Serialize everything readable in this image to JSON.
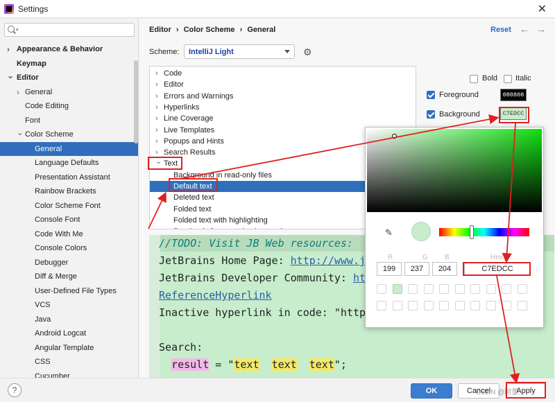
{
  "window": {
    "title": "Settings"
  },
  "sidebar": {
    "search_placeholder": "",
    "items": [
      {
        "label": "Appearance & Behavior",
        "level": 0,
        "bold": true,
        "chevron": "right"
      },
      {
        "label": "Keymap",
        "level": 0,
        "bold": true,
        "chevron": ""
      },
      {
        "label": "Editor",
        "level": 0,
        "bold": true,
        "chevron": "down"
      },
      {
        "label": "General",
        "level": 1,
        "bold": false,
        "chevron": "right"
      },
      {
        "label": "Code Editing",
        "level": 1,
        "bold": false,
        "chevron": ""
      },
      {
        "label": "Font",
        "level": 1,
        "bold": false,
        "chevron": ""
      },
      {
        "label": "Color Scheme",
        "level": 1,
        "bold": false,
        "chevron": "down"
      },
      {
        "label": "General",
        "level": 2,
        "bold": false,
        "chevron": "",
        "selected": true
      },
      {
        "label": "Language Defaults",
        "level": 2,
        "bold": false,
        "chevron": ""
      },
      {
        "label": "Presentation Assistant",
        "level": 2,
        "bold": false,
        "chevron": ""
      },
      {
        "label": "Rainbow Brackets",
        "level": 2,
        "bold": false,
        "chevron": ""
      },
      {
        "label": "Color Scheme Font",
        "level": 2,
        "bold": false,
        "chevron": ""
      },
      {
        "label": "Console Font",
        "level": 2,
        "bold": false,
        "chevron": ""
      },
      {
        "label": "Code With Me",
        "level": 2,
        "bold": false,
        "chevron": ""
      },
      {
        "label": "Console Colors",
        "level": 2,
        "bold": false,
        "chevron": ""
      },
      {
        "label": "Debugger",
        "level": 2,
        "bold": false,
        "chevron": ""
      },
      {
        "label": "Diff & Merge",
        "level": 2,
        "bold": false,
        "chevron": ""
      },
      {
        "label": "User-Defined File Types",
        "level": 2,
        "bold": false,
        "chevron": ""
      },
      {
        "label": "VCS",
        "level": 2,
        "bold": false,
        "chevron": ""
      },
      {
        "label": "Java",
        "level": 2,
        "bold": false,
        "chevron": ""
      },
      {
        "label": "Android Logcat",
        "level": 2,
        "bold": false,
        "chevron": ""
      },
      {
        "label": "Angular Template",
        "level": 2,
        "bold": false,
        "chevron": ""
      },
      {
        "label": "CSS",
        "level": 2,
        "bold": false,
        "chevron": ""
      },
      {
        "label": "Cucumber",
        "level": 2,
        "bold": false,
        "chevron": ""
      }
    ]
  },
  "breadcrumb": {
    "part1": "Editor",
    "sep": "›",
    "part2": "Color Scheme",
    "part3": "General"
  },
  "header": {
    "reset": "Reset",
    "back": "←",
    "forward": "→"
  },
  "scheme": {
    "label": "Scheme:",
    "value": "IntelliJ Light"
  },
  "categories": [
    {
      "label": "Code",
      "expanded": false
    },
    {
      "label": "Editor",
      "expanded": false
    },
    {
      "label": "Errors and Warnings",
      "expanded": false
    },
    {
      "label": "Hyperlinks",
      "expanded": false
    },
    {
      "label": "Line Coverage",
      "expanded": false
    },
    {
      "label": "Live Templates",
      "expanded": false
    },
    {
      "label": "Popups and Hints",
      "expanded": false
    },
    {
      "label": "Search Results",
      "expanded": false
    },
    {
      "label": "Text",
      "expanded": true
    },
    {
      "label": "Background in read-only files",
      "child": true
    },
    {
      "label": "Default text",
      "child": true,
      "selected": true
    },
    {
      "label": "Deleted text",
      "child": true
    },
    {
      "label": "Folded text",
      "child": true
    },
    {
      "label": "Folded text with highlighting",
      "child": true
    },
    {
      "label": "Read-only fragment background",
      "child": true
    }
  ],
  "options": {
    "bold": {
      "label": "Bold",
      "checked": false
    },
    "italic": {
      "label": "Italic",
      "checked": false
    },
    "foreground": {
      "label": "Foreground",
      "checked": true,
      "value": "080808",
      "color": "#080808"
    },
    "background": {
      "label": "Background",
      "checked": true,
      "value": "C7EDCC",
      "color": "#C7EDCC"
    }
  },
  "preview": {
    "todo": "//TODO: Visit JB Web resources:",
    "home_label": "JetBrains Home Page: ",
    "home_link": "http://www.j",
    "community_label": "JetBrains Developer Community: ",
    "community_link": "ht",
    "ref": "ReferenceHyperlink",
    "inactive": "Inactive hyperlink in code: \"http",
    "search": "Search:",
    "result_var": "result",
    "result_eq": " = \"",
    "text1": "text",
    "text2": "text",
    "text3": "text",
    "result_end": "\";"
  },
  "picker": {
    "r_label": "R",
    "g_label": "G",
    "b_label": "B",
    "hex_label": "Hex",
    "r": "199",
    "g": "237",
    "b": "204",
    "hex": "C7EDCC",
    "current_color": "#C7EDCC",
    "hue_position": 0.36
  },
  "footer": {
    "help": "?",
    "ok": "OK",
    "cancel": "Cancel",
    "apply": "Apply",
    "watermark": "CSDN @阿里..."
  },
  "colors": {
    "accent": "#2f6fbd",
    "annotation": "#e02020",
    "preview_bg": "#C7EDCC"
  }
}
